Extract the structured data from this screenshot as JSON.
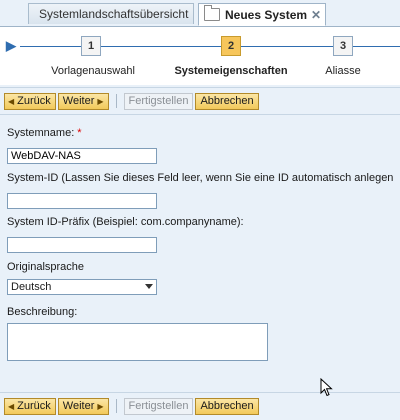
{
  "tabs": [
    {
      "label": "Systemlandschaftsübersicht"
    },
    {
      "label": "Neues System"
    }
  ],
  "icons": {
    "tab_folder": "folder-icon",
    "tab_close": "close-icon",
    "roadmap_start": "roadmap-start-icon",
    "prev_arrow": "arrow-left-icon",
    "next_arrow": "arrow-right-icon",
    "pointer": "mouse-pointer-icon"
  },
  "roadmap": {
    "steps": [
      {
        "number": "1",
        "label": "Vorlagenauswahl",
        "active": false
      },
      {
        "number": "2",
        "label": "Systemeigenschaften",
        "active": true
      },
      {
        "number": "3",
        "label": "Aliasse",
        "active": false
      }
    ]
  },
  "toolbar": {
    "back_label": "Zurück",
    "next_label": "Weiter",
    "finish_label": "Fertigstellen",
    "cancel_label": "Abbrechen"
  },
  "form": {
    "system_name_label": "Systemname:",
    "system_name_required": "*",
    "system_name_value": "WebDAV-NAS",
    "system_id_label": "System-ID (Lassen Sie dieses Feld leer, wenn Sie eine ID automatisch anlegen",
    "system_id_value": "",
    "prefix_label": "System ID-Präfix (Beispiel: com.companyname):",
    "prefix_value": "",
    "language_label": "Originalsprache",
    "language_value": "Deutsch",
    "description_label": "Beschreibung:",
    "description_value": ""
  },
  "colors": {
    "accent": "#2f6db0",
    "button": "#f2c95b",
    "active_step": "#f7c65b",
    "background": "#e9f1f9"
  }
}
